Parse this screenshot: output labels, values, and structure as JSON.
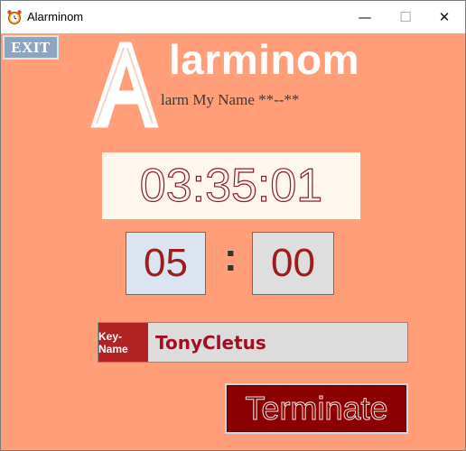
{
  "window": {
    "title": "Alarminom",
    "controls": {
      "minimize": "—",
      "maximize": "☐",
      "close": "✕"
    }
  },
  "toolbar": {
    "exit_label": "EXIT"
  },
  "logo": {
    "letter": "A",
    "word": "larminom",
    "subtitle": "larm My Name **--**"
  },
  "clock": {
    "time": "03:35:01"
  },
  "alarm": {
    "hours": "05",
    "separator": ":",
    "minutes": "00"
  },
  "keyname": {
    "label": "Key-Name",
    "value": "TonyCletus"
  },
  "actions": {
    "terminate_label": "Terminate"
  },
  "colors": {
    "background": "#ff9e78",
    "accent_red": "#b22222",
    "terminate_bg": "#8b0000",
    "clock_stroke": "#8c1a2e"
  }
}
